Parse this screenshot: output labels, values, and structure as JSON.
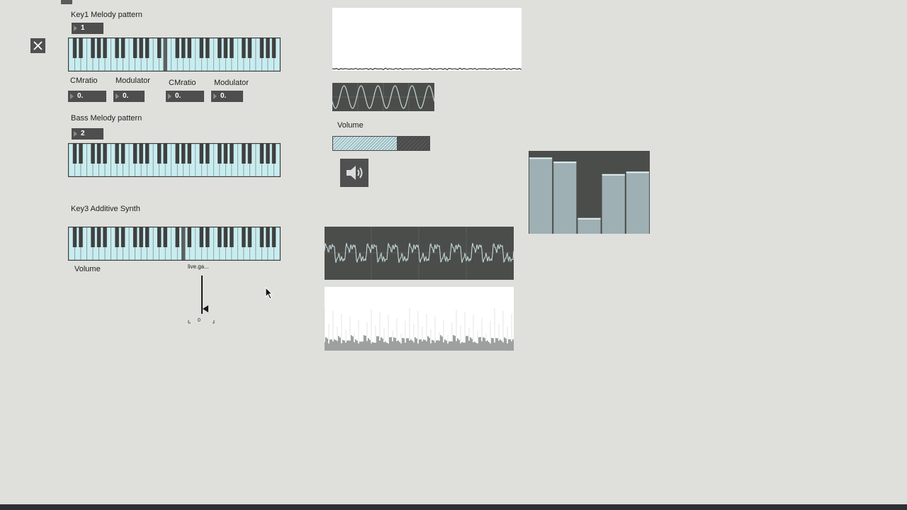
{
  "key1": {
    "label": "Key1 Melody pattern",
    "number": "1"
  },
  "fm": {
    "cmratio1_label": "CMratio",
    "modulator1_label": "Modulator",
    "cmratio2_label": "CMratio",
    "modulator2_label": "Modulator",
    "cmratio1_value": "0.",
    "modulator1_value": "0.",
    "cmratio2_value": "0.",
    "modulator2_value": "0."
  },
  "bass": {
    "label": "Bass Melody pattern",
    "number": "2"
  },
  "key3": {
    "label": "Key3 Additive Synth"
  },
  "volume_left": {
    "label": "Volume"
  },
  "gain": {
    "title": "live.ga...",
    "value": "0"
  },
  "volume_slider": {
    "label": "Volume",
    "level": 0.66
  },
  "multislider": {
    "values": [
      0.92,
      0.87,
      0.19,
      0.72,
      0.75
    ]
  },
  "colors": {
    "key_white": "#c9ecef",
    "key_black": "#3f403f",
    "panel_dark": "#4b4d4b",
    "bar": "#9eb0b3",
    "background": "#dfdfdb"
  },
  "icons": {
    "close": "close-icon",
    "speaker": "speaker-icon"
  }
}
